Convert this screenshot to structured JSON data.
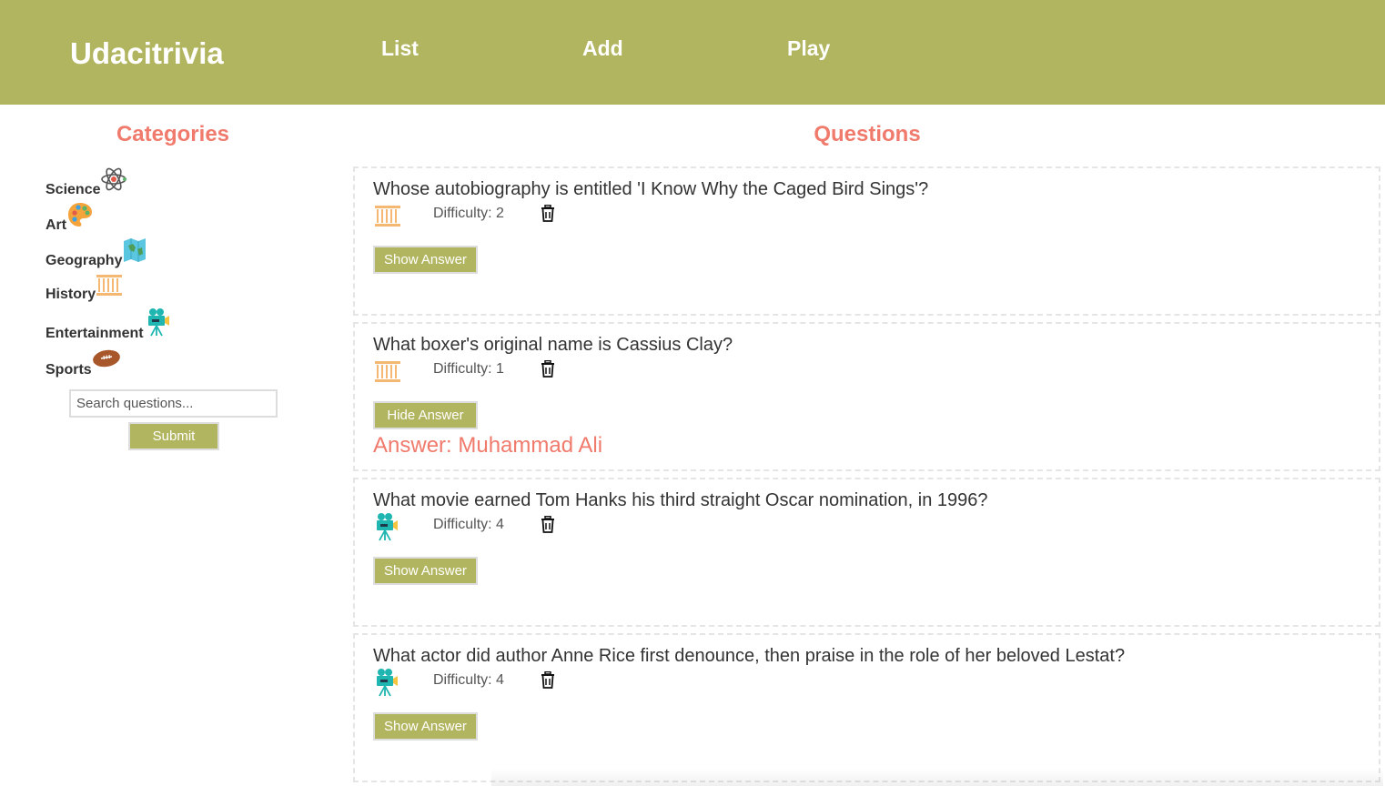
{
  "header": {
    "logo": "Udacitrivia",
    "nav": [
      "List",
      "Add",
      "Play"
    ]
  },
  "sidebar": {
    "title": "Categories",
    "categories": [
      {
        "label": "Science",
        "icon": "science-atom-icon"
      },
      {
        "label": "Art",
        "icon": "art-palette-icon"
      },
      {
        "label": "Geography",
        "icon": "geography-map-icon"
      },
      {
        "label": "History",
        "icon": "history-columns-icon"
      },
      {
        "label": "Entertainment",
        "icon": "entertainment-camera-icon"
      },
      {
        "label": "Sports",
        "icon": "sports-football-icon"
      }
    ],
    "search_placeholder": "Search questions...",
    "submit_label": "Submit"
  },
  "main": {
    "title": "Questions",
    "questions": [
      {
        "text": "Whose autobiography is entitled 'I Know Why the Caged Bird Sings'?",
        "category_icon": "history-columns-icon",
        "difficulty": "Difficulty: 2",
        "button": "Show Answer",
        "answer": ""
      },
      {
        "text": "What boxer's original name is Cassius Clay?",
        "category_icon": "history-columns-icon",
        "difficulty": "Difficulty: 1",
        "button": "Hide Answer",
        "answer": "Answer: Muhammad Ali"
      },
      {
        "text": "What movie earned Tom Hanks his third straight Oscar nomination, in 1996?",
        "category_icon": "entertainment-camera-icon",
        "difficulty": "Difficulty: 4",
        "button": "Show Answer",
        "answer": ""
      },
      {
        "text": "What actor did author Anne Rice first denounce, then praise in the role of her beloved Lestat?",
        "category_icon": "entertainment-camera-icon",
        "difficulty": "Difficulty: 4",
        "button": "Show Answer",
        "answer": ""
      }
    ]
  },
  "colors": {
    "header_bg": "#b2b55f",
    "accent": "#f07a6c",
    "button_bg": "#b2b55f"
  }
}
